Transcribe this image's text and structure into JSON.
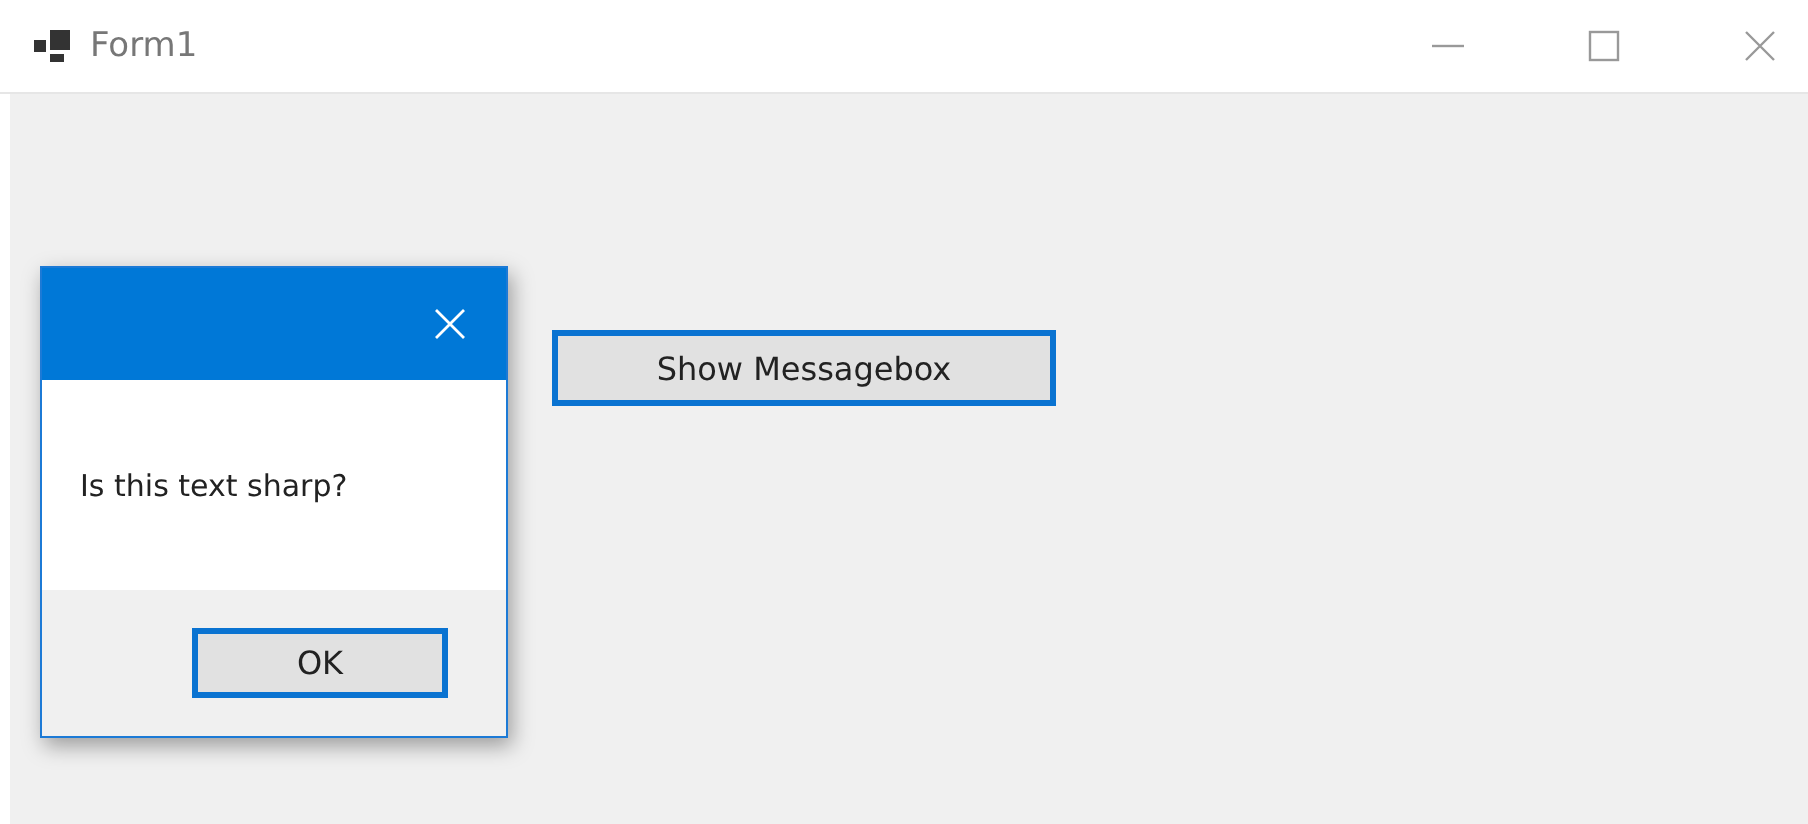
{
  "window": {
    "title": "Form1"
  },
  "form": {
    "button": "Show Messagebox"
  },
  "message_box": {
    "message": "Is this text sharp?",
    "button": "OK"
  }
}
